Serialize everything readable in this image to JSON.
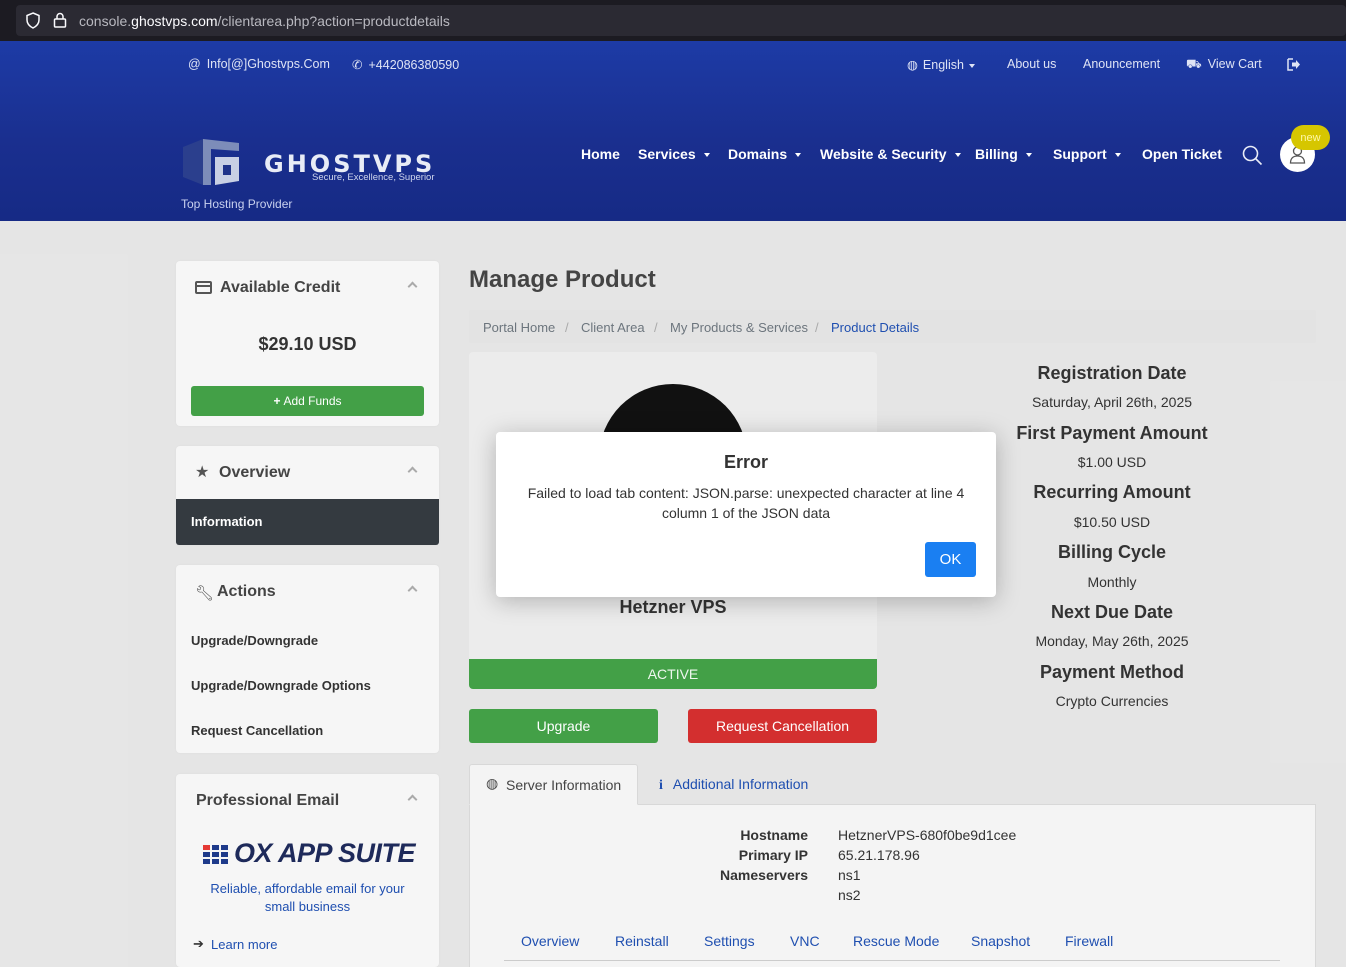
{
  "browser": {
    "url_prefix": "console.",
    "url_domain": "ghostvps.com",
    "url_path": "/clientarea.php?action=productdetails"
  },
  "topbar": {
    "email": "Info[@]Ghostvps.Com",
    "phone": "+442086380590",
    "language": "English",
    "about": "About us",
    "announcement": "Anouncement",
    "cart": "View Cart"
  },
  "logo": {
    "name": "GHOSTVPS",
    "slogan": "Secure, Excellence, Superior",
    "tagline": "Top Hosting Provider"
  },
  "nav": {
    "items": [
      "Home",
      "Services",
      "Domains",
      "Website & Security",
      "Billing",
      "Support",
      "Open Ticket"
    ],
    "badge": "new"
  },
  "sidebar": {
    "credit": {
      "title": "Available Credit",
      "amount": "$29.10 USD",
      "button": "Add Funds"
    },
    "overview": {
      "title": "Overview",
      "active_item": "Information"
    },
    "actions": {
      "title": "Actions",
      "items": [
        "Upgrade/Downgrade",
        "Upgrade/Downgrade Options",
        "Request Cancellation"
      ]
    },
    "email": {
      "title": "Professional Email",
      "brand": "OX APP SUITE",
      "description": "Reliable, affordable email for your small business",
      "link": "Learn more"
    }
  },
  "main": {
    "title": "Manage Product",
    "breadcrumb": [
      "Portal Home",
      "Client Area",
      "My Products & Services",
      "Product Details"
    ],
    "product": {
      "name": "Hetzner VPS",
      "status": "ACTIVE",
      "upgrade": "Upgrade",
      "cancel": "Request Cancellation"
    },
    "details": [
      {
        "label": "Registration Date",
        "value": "Saturday, April 26th, 2025"
      },
      {
        "label": "First Payment Amount",
        "value": "$1.00 USD"
      },
      {
        "label": "Recurring Amount",
        "value": "$10.50 USD"
      },
      {
        "label": "Billing Cycle",
        "value": "Monthly"
      },
      {
        "label": "Next Due Date",
        "value": "Monday, May 26th, 2025"
      },
      {
        "label": "Payment Method",
        "value": "Crypto Currencies"
      }
    ],
    "tabs": [
      "Server Information",
      "Additional Information"
    ],
    "server": {
      "hostname_label": "Hostname",
      "hostname": "HetznerVPS-680f0be9d1cee",
      "ip_label": "Primary IP",
      "ip": "65.21.178.96",
      "ns_label": "Nameservers",
      "ns1": "ns1",
      "ns2": "ns2"
    },
    "subtabs": [
      "Overview",
      "Reinstall",
      "Settings",
      "VNC",
      "Rescue Mode",
      "Snapshot",
      "Firewall"
    ]
  },
  "modal": {
    "title": "Error",
    "message": "Failed to load tab content: JSON.parse: unexpected character at line 4 column 1 of the JSON data",
    "ok": "OK"
  },
  "colors": {
    "header": "#1a2f8f",
    "green": "#43a047",
    "red": "#d32f2f",
    "ok_blue": "#1a7ff2",
    "link_blue": "#1f4fb0"
  }
}
